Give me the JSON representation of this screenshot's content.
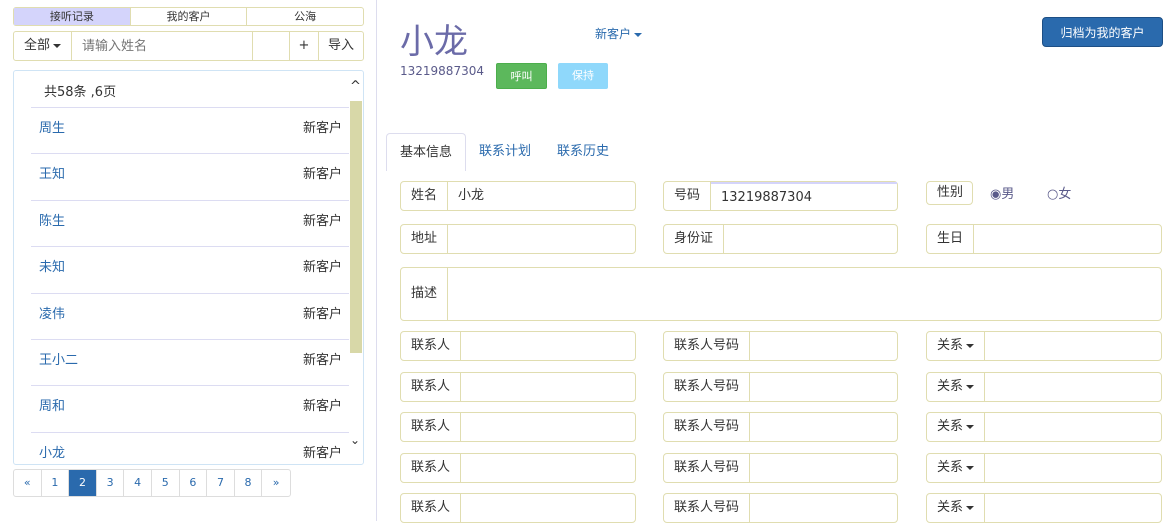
{
  "left": {
    "tabs": [
      "接听记录",
      "我的客户",
      "公海"
    ],
    "filter": "全部",
    "search_placeholder": "请输入姓名",
    "add": "+",
    "import": "导入",
    "count": "共58条 ,6页",
    "rows": [
      {
        "name": "周生",
        "status": "新客户"
      },
      {
        "name": "王知",
        "status": "新客户"
      },
      {
        "name": "陈生",
        "status": "新客户"
      },
      {
        "name": "未知",
        "status": "新客户"
      },
      {
        "name": "凌伟",
        "status": "新客户"
      },
      {
        "name": "王小二",
        "status": "新客户"
      },
      {
        "name": "周和",
        "status": "新客户"
      },
      {
        "name": "小龙",
        "status": "新客户"
      }
    ],
    "pages": [
      "«",
      "1",
      "2",
      "3",
      "4",
      "5",
      "6",
      "7",
      "8",
      "»"
    ],
    "current_page": "2"
  },
  "main": {
    "name": "小龙",
    "status": "新客户",
    "phone": "13219887304",
    "call": "呼叫",
    "hold": "保持",
    "archive": "归档为我的客户",
    "tabs": [
      "基本信息",
      "联系计划",
      "联系历史"
    ],
    "form": {
      "name_label": "姓名",
      "name_value": "小龙",
      "phone_label": "号码",
      "phone_value": "13219887304",
      "gender_label": "性别",
      "male": "男",
      "female": "女",
      "address_label": "地址",
      "id_label": "身份证",
      "birthday_label": "生日",
      "desc_label": "描述",
      "contact_label": "联系人",
      "contact_phone_label": "联系人号码",
      "relation_label": "关系"
    }
  }
}
